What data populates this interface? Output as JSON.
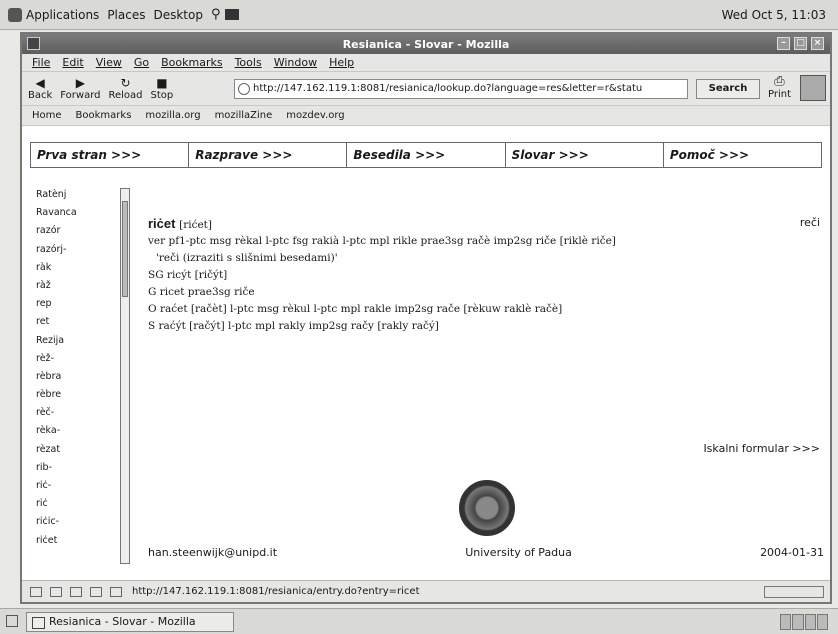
{
  "top_panel": {
    "menus": [
      "Applications",
      "Places",
      "Desktop"
    ],
    "clock": "Wed Oct 5, 11:03"
  },
  "window": {
    "title": "Resianica - Slovar - Mozilla",
    "menu": [
      "File",
      "Edit",
      "View",
      "Go",
      "Bookmarks",
      "Tools",
      "Window",
      "Help"
    ],
    "nav_buttons": [
      {
        "label": "Back",
        "icon": "back-arrow-icon"
      },
      {
        "label": "Forward",
        "icon": "forward-arrow-icon"
      },
      {
        "label": "Reload",
        "icon": "reload-icon"
      },
      {
        "label": "Stop",
        "icon": "stop-icon"
      }
    ],
    "url": "http://147.162.119.1:8081/resianica/lookup.do?language=res&letter=r&statu",
    "search_label": "Search",
    "print_label": "Print",
    "bookmarks": [
      "Home",
      "Bookmarks",
      "mozilla.org",
      "mozillaZine",
      "mozdev.org"
    ]
  },
  "site": {
    "tabs": [
      "Prva stran >>>",
      "Razprave >>>",
      "Besedila >>>",
      "Slovar >>>",
      "Pomoč >>>"
    ],
    "word_list": [
      "Ratènj",
      "Ravanca",
      "razór",
      "razórj-",
      "ràk",
      "ràž",
      "rep",
      "ret",
      "Rezija",
      "rèž-",
      "rèbra",
      "rèbre",
      "rèč-",
      "rèka-",
      "rèzat",
      "rib-",
      "riċ-",
      "riċ",
      "riċic-",
      "riċet"
    ],
    "entry": {
      "headword": "riċet",
      "headword_bracket": "[rićet]",
      "related_link": "reči",
      "lines": [
        "ver pf1-ptc msg rèkal l-ptc fsg rakià l-ptc mpl rikle prae3sg račè imp2sg riče [riklè riče]",
        "'reči (izraziti s slišnimi besedami)'",
        "SG ricýt [ričýt]",
        "G ricet prae3sg riče",
        "O raćet [račèt] l-ptc msg rèkul l-ptc mpl rakle imp2sg rače [rèkuw raklè račè]",
        "S raćýt [račýt] l-ptc mpl rakly imp2sg račy [rakly račý]"
      ]
    },
    "form_link": "Iskalni formular >>>",
    "footer": {
      "email": "han.steenwijk@unipd.it",
      "org": "University of Padua",
      "date": "2004-01-31"
    }
  },
  "statusbar": {
    "text": "http://147.162.119.1:8081/resianica/entry.do?entry=ricet"
  },
  "taskbar": {
    "task_label": "Resianica - Slovar - Mozilla"
  }
}
